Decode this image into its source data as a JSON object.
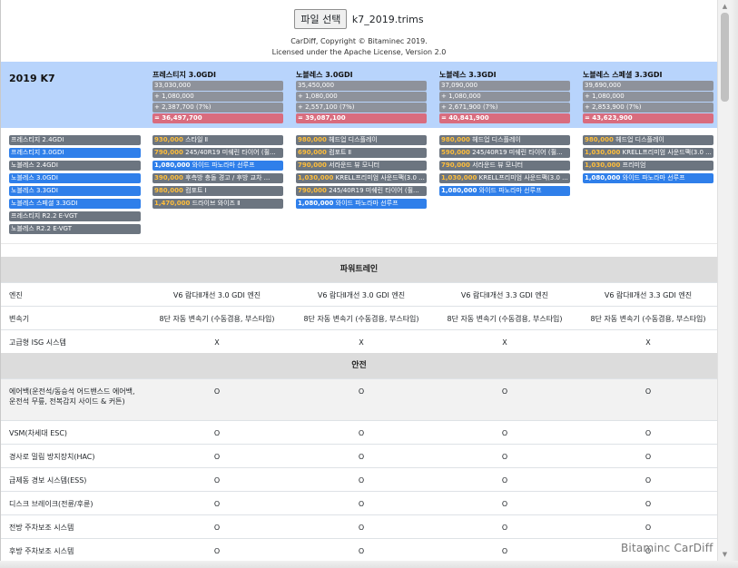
{
  "file": {
    "button_label": "파일 선택",
    "file_name": "k7_2019.trims"
  },
  "copyright": {
    "line1": "CarDiff, Copyright © Bitaminec 2019.",
    "line2": "Licensed under the Apache License, Version 2.0"
  },
  "model_title": "2019 K7",
  "trims": [
    {
      "name": "프레스티지 3.0GDI",
      "base": "33,030,000",
      "options": "+ 1,080,000",
      "tax": "+ 2,387,700 (7%)",
      "total": "= 36,497,700"
    },
    {
      "name": "노블레스 3.0GDI",
      "base": "35,450,000",
      "options": "+ 1,080,000",
      "tax": "+ 2,557,100 (7%)",
      "total": "= 39,087,100"
    },
    {
      "name": "노블레스 3.3GDI",
      "base": "37,090,000",
      "options": "+ 1,080,000",
      "tax": "+ 2,671,900 (7%)",
      "total": "= 40,841,900"
    },
    {
      "name": "노블레스 스페셜 3.3GDI",
      "base": "39,690,000",
      "options": "+ 1,080,000",
      "tax": "+ 2,853,900 (7%)",
      "total": "= 43,623,900"
    }
  ],
  "trim_list": [
    {
      "label": "프레스티지 2.4GDI",
      "selected": false
    },
    {
      "label": "프레스티지 3.0GDI",
      "selected": true
    },
    {
      "label": "노블레스 2.4GDI",
      "selected": false
    },
    {
      "label": "노블레스 3.0GDI",
      "selected": true
    },
    {
      "label": "노블레스 3.3GDI",
      "selected": true
    },
    {
      "label": "노블레스 스페셜 3.3GDI",
      "selected": true
    },
    {
      "label": "프레스티지 R2.2 E-VGT",
      "selected": false
    },
    {
      "label": "노블레스 R2.2 E-VGT",
      "selected": false
    }
  ],
  "option_columns": [
    [
      {
        "price": "930,000",
        "name": "스타일 Ⅱ",
        "selected": false
      },
      {
        "price": "790,000",
        "name": "245/40R19 미쉐린 타이어 (휠...",
        "selected": false
      },
      {
        "price": "1,080,000",
        "name": "와이드 파노라마 선루프",
        "selected": true
      },
      {
        "price": "390,000",
        "name": "후측방 충돌 경고 / 후방 교차 ...",
        "selected": false
      },
      {
        "price": "980,000",
        "name": "컴포트 Ⅰ",
        "selected": false
      },
      {
        "price": "1,470,000",
        "name": "드라이브 와이즈 Ⅱ",
        "selected": false
      }
    ],
    [
      {
        "price": "980,000",
        "name": "헤드업 디스플레이",
        "selected": false
      },
      {
        "price": "690,000",
        "name": "컴포트 Ⅱ",
        "selected": false
      },
      {
        "price": "790,000",
        "name": "서라운드 뷰 모니터",
        "selected": false
      },
      {
        "price": "1,030,000",
        "name": "KRELL프리미엄 사운드팩(3.0 ...",
        "selected": false
      },
      {
        "price": "790,000",
        "name": "245/40R19 미쉐린 타이어 (휠...",
        "selected": false
      },
      {
        "price": "1,080,000",
        "name": "와이드 파노라마 선루프",
        "selected": true
      }
    ],
    [
      {
        "price": "980,000",
        "name": "헤드업 디스플레이",
        "selected": false
      },
      {
        "price": "590,000",
        "name": "245/40R19 미쉐린 타이어 (휠...",
        "selected": false
      },
      {
        "price": "790,000",
        "name": "서라운드 뷰 모니터",
        "selected": false
      },
      {
        "price": "1,030,000",
        "name": "KRELL프리미엄 사운드팩(3.0 ...",
        "selected": false
      },
      {
        "price": "1,080,000",
        "name": "와이드 파노라마 선루프",
        "selected": true
      }
    ],
    [
      {
        "price": "980,000",
        "name": "헤드업 디스플레이",
        "selected": false
      },
      {
        "price": "1,030,000",
        "name": "KRELL프리미엄 사운드팩(3.0 ...",
        "selected": false
      },
      {
        "price": "1,030,000",
        "name": "프리미엄",
        "selected": false
      },
      {
        "price": "1,080,000",
        "name": "와이드 파노라마 선루프",
        "selected": true
      }
    ]
  ],
  "sections": [
    {
      "title": "파워트레인",
      "rows": [
        {
          "label": "엔진",
          "values": [
            "V6 람다Ⅱ개선 3.0 GDI 엔진",
            "V6 람다Ⅱ개선 3.0 GDI 엔진",
            "V6 람다Ⅱ개선 3.3 GDI 엔진",
            "V6 람다Ⅱ개선 3.3 GDI 엔진"
          ]
        },
        {
          "label": "변속기",
          "values": [
            "8단 자동 변속기 (수동겸용, 부스타입)",
            "8단 자동 변속기 (수동겸용, 부스타입)",
            "8단 자동 변속기 (수동겸용, 부스타입)",
            "8단 자동 변속기 (수동겸용, 부스타입)"
          ]
        },
        {
          "label": "고급형 ISG 시스템",
          "values": [
            "X",
            "X",
            "X",
            "X"
          ]
        }
      ]
    },
    {
      "title": "안전",
      "rows": [
        {
          "label": "에어백(운전석/동승석 어드밴스드 에어백, 운전석 무릎, 전복감지 사이드 & 커튼)",
          "values": [
            "O",
            "O",
            "O",
            "O"
          ]
        },
        {
          "label": "VSM(차세대 ESC)",
          "values": [
            "O",
            "O",
            "O",
            "O"
          ]
        },
        {
          "label": "경사로 밀림 방지장치(HAC)",
          "values": [
            "O",
            "O",
            "O",
            "O"
          ]
        },
        {
          "label": "급제동 경보 시스템(ESS)",
          "values": [
            "O",
            "O",
            "O",
            "O"
          ]
        },
        {
          "label": "디스크 브레이크(전륜/후륜)",
          "values": [
            "O",
            "O",
            "O",
            "O"
          ]
        },
        {
          "label": "전방 주차보조 시스템",
          "values": [
            "O",
            "O",
            "O",
            "O"
          ]
        },
        {
          "label": "후방 주차보조 시스템",
          "values": [
            "O",
            "O",
            "O",
            "O"
          ]
        }
      ]
    }
  ],
  "watermark": "Bitaminc CarDiff",
  "colors": {
    "summary_bg": "#b8d4fc",
    "price_box": "#8e929b",
    "total_box": "#d96c7e",
    "tag_gray": "#6c7580",
    "tag_blue": "#2f7fea",
    "option_price": "#ffbe3a",
    "section_bg": "#dcdcdc"
  }
}
